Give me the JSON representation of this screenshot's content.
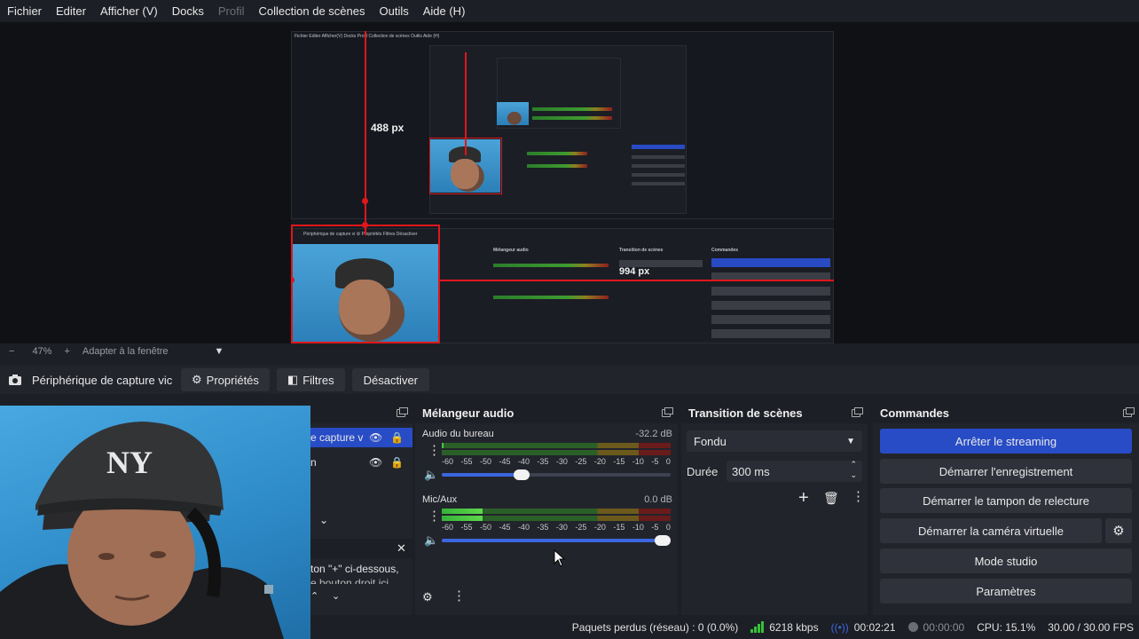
{
  "menu": [
    "Fichier",
    "Editer",
    "Afficher (V)",
    "Docks",
    "Profil",
    "Collection de scènes",
    "Outils",
    "Aide (H)"
  ],
  "preview": {
    "measure_v": "488 px",
    "measure_h": "994 px"
  },
  "zoombar": {
    "minus": "−",
    "zoom": "47%",
    "plus": "+",
    "fit": "Adapter à la fenêtre",
    "caret": "▼"
  },
  "source_toolbar": {
    "source_name": "Périphérique de capture vic",
    "properties": "Propriétés",
    "filters": "Filtres",
    "deactivate": "Désactiver"
  },
  "sources": {
    "item1": "e capture v",
    "item2": "n",
    "help_text_1": "ton \"+\" ci-dessous,",
    "help_text_2": "e bouton droit ici"
  },
  "mixer": {
    "title": "Mélangeur audio",
    "channels": [
      {
        "name": "Audio du bureau",
        "db": "-32.2 dB",
        "volume": 0.35,
        "level": 0.0
      },
      {
        "name": "Mic/Aux",
        "db": "0.0 dB",
        "volume": 1.0,
        "level": 0.18
      }
    ],
    "ticks": [
      "-60",
      "-55",
      "-50",
      "-45",
      "-40",
      "-35",
      "-30",
      "-25",
      "-20",
      "-15",
      "-10",
      "-5",
      "0"
    ]
  },
  "transition": {
    "title": "Transition de scènes",
    "selected": "Fondu",
    "duration_label": "Durée",
    "duration_value": "300 ms"
  },
  "controls": {
    "title": "Commandes",
    "stop_streaming": "Arrêter le streaming",
    "start_recording": "Démarrer l'enregistrement",
    "start_replay": "Démarrer le tampon de relecture",
    "start_virtualcam": "Démarrer la caméra virtuelle",
    "studio_mode": "Mode studio",
    "settings": "Paramètres"
  },
  "status": {
    "dropped": "Paquets perdus (réseau) : 0 (0.0%)",
    "bitrate": "6218 kbps",
    "stream_time": "00:02:21",
    "rec_time": "00:00:00",
    "cpu": "CPU: 15.1%",
    "fps": "30.00 / 30.00 FPS"
  },
  "colors": {
    "accent_blue": "#284cc6",
    "measure_red": "#e0161b",
    "meter_green": "#36b23a"
  }
}
